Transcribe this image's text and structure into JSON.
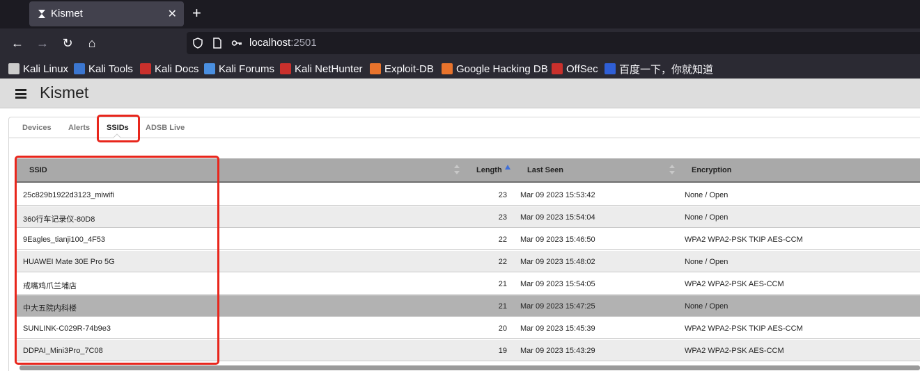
{
  "browser": {
    "tab_title": "Kismet",
    "tab_close": "✕",
    "new_tab": "+",
    "url_host": "localhost",
    "url_port": ":2501",
    "nav": {
      "back": "←",
      "forward": "→",
      "reload": "↻",
      "home": "⌂"
    },
    "bookmarks": [
      {
        "label": "Kali Linux",
        "color": "#cccccc"
      },
      {
        "label": "Kali Tools",
        "color": "#3b76d0"
      },
      {
        "label": "Kali Docs",
        "color": "#c9302c"
      },
      {
        "label": "Kali Forums",
        "color": "#4a8fe0"
      },
      {
        "label": "Kali NetHunter",
        "color": "#c9302c"
      },
      {
        "label": "Exploit-DB",
        "color": "#e8732c"
      },
      {
        "label": "Google Hacking DB",
        "color": "#e8732c"
      },
      {
        "label": "OffSec",
        "color": "#c9302c"
      },
      {
        "label": "百度一下，你就知道",
        "color": "#2f5fd6"
      }
    ]
  },
  "app": {
    "title": "Kismet",
    "tabs": [
      "Devices",
      "Alerts",
      "SSIDs",
      "ADSB Live"
    ],
    "active_tab": "SSIDs"
  },
  "table": {
    "columns": {
      "ssid": "SSID",
      "length": "Length",
      "last_seen": "Last Seen",
      "encryption": "Encryption"
    },
    "sorted_by": "Length",
    "rows": [
      {
        "ssid": "25c829b1922d3123_miwifi",
        "length": "23",
        "last_seen": "Mar 09 2023 15:53:42",
        "encryption": "None / Open"
      },
      {
        "ssid": "360行车记录仪-80D8",
        "length": "23",
        "last_seen": "Mar 09 2023 15:54:04",
        "encryption": "None / Open"
      },
      {
        "ssid": "9Eagles_tianji100_4F53",
        "length": "22",
        "last_seen": "Mar 09 2023 15:46:50",
        "encryption": "WPA2 WPA2-PSK TKIP AES-CCM"
      },
      {
        "ssid": "HUAWEI Mate 30E Pro 5G",
        "length": "22",
        "last_seen": "Mar 09 2023 15:48:02",
        "encryption": "None / Open"
      },
      {
        "ssid": "戒嘴鸡爪兰埔店",
        "length": "21",
        "last_seen": "Mar 09 2023 15:54:05",
        "encryption": "WPA2 WPA2-PSK AES-CCM"
      },
      {
        "ssid": "中大五院内科楼",
        "length": "21",
        "last_seen": "Mar 09 2023 15:47:25",
        "encryption": "None / Open"
      },
      {
        "ssid": "SUNLINK-C029R-74b9e3",
        "length": "20",
        "last_seen": "Mar 09 2023 15:45:39",
        "encryption": "WPA2 WPA2-PSK TKIP AES-CCM"
      },
      {
        "ssid": "DDPAI_Mini3Pro_7C08",
        "length": "19",
        "last_seen": "Mar 09 2023 15:43:29",
        "encryption": "WPA2 WPA2-PSK AES-CCM"
      }
    ]
  }
}
